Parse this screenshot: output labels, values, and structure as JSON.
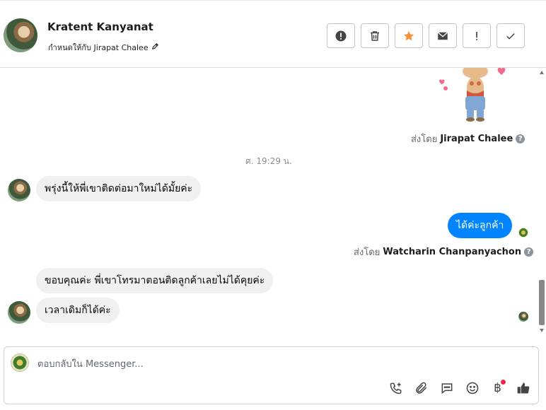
{
  "header": {
    "contact_name": "Kratent Kanyanat",
    "assigned_to": "กำหนดให้กับ Jirapat Chalee",
    "actions": [
      {
        "name": "report-spam-button",
        "icon": "alert-circle-icon"
      },
      {
        "name": "delete-button",
        "icon": "trash-icon"
      },
      {
        "name": "follow-up-button",
        "icon": "star-icon"
      },
      {
        "name": "mark-unread-button",
        "icon": "envelope-icon"
      },
      {
        "name": "priority-button",
        "icon": "exclamation-icon"
      },
      {
        "name": "mark-done-button",
        "icon": "check-icon"
      }
    ]
  },
  "thread": {
    "sticker_sent_by_prefix": "ส่งโดย",
    "sticker_sent_by_name": "Jirapat Chalee",
    "timestamp": "ศ. 19:29 น.",
    "messages": [
      {
        "direction": "in",
        "text": "พรุ่งนี้ให้พี่เขาติดต่อมาใหม่ได้มั้ยค่ะ"
      },
      {
        "direction": "out",
        "text": "ได้ค่ะลูกค้า"
      },
      {
        "direction": "in",
        "text": "ขอบคุณค่ะ พี่เขาโทรมาตอนติดลูกค้าเลยไม่ได้คุยค่ะ"
      },
      {
        "direction": "in",
        "text": "เวลาเดิมก็ได้ค่ะ"
      }
    ],
    "reply_sent_by_prefix": "ส่งโดย",
    "reply_sent_by_name": "Watcharin Chanpanyachon",
    "help_icon": "question-circle-icon"
  },
  "composer": {
    "placeholder": "ตอบกลับใน Messenger...",
    "value": "",
    "tools": [
      "phone-add-icon",
      "paperclip-icon",
      "saved-reply-icon",
      "emoji-icon",
      "baht-payment-icon",
      "thumbs-up-icon"
    ],
    "baht_symbol": "฿"
  },
  "colors": {
    "outgoing_bubble": "#0084ff",
    "incoming_bubble": "#f0f0f0",
    "star": "#f7923a",
    "notification_dot": "#f0284a"
  }
}
